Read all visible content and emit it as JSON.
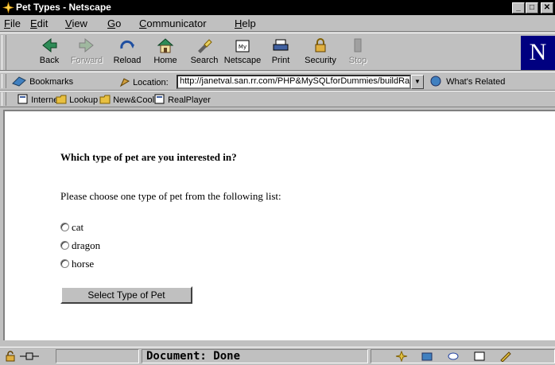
{
  "window": {
    "title": "Pet Types - Netscape"
  },
  "menu": [
    {
      "label": "File",
      "underline": "F",
      "rest": "ile"
    },
    {
      "label": "Edit",
      "underline": "E",
      "rest": "dit"
    },
    {
      "label": "View",
      "underline": "V",
      "rest": "iew"
    },
    {
      "label": "Go",
      "underline": "G",
      "rest": "o"
    },
    {
      "label": "Communicator",
      "underline": "C",
      "rest": "ommunicator"
    },
    {
      "label": "Help",
      "underline": "H",
      "rest": "elp"
    }
  ],
  "toolbar": {
    "back": "Back",
    "forward": "Forward",
    "reload": "Reload",
    "home": "Home",
    "search": "Search",
    "netscape": "Netscape",
    "print": "Print",
    "security": "Security",
    "stop": "Stop",
    "logo": "N"
  },
  "location_bar": {
    "bookmarks": "Bookmarks",
    "location_label": "Location:",
    "url": "http://janetval.san.rr.com/PHP&MySQLforDummies/buildRa",
    "whats_related": "What's Related"
  },
  "personal_toolbar": [
    "Internet",
    "Lookup",
    "New&Cool",
    "RealPlayer"
  ],
  "page": {
    "heading": "Which type of pet are you interested in?",
    "instruction": "Please choose one type of pet from the following list:",
    "options": [
      "cat",
      "dragon",
      "horse"
    ],
    "submit_label": "Select Type of Pet"
  },
  "status": {
    "text": "Document: Done"
  },
  "colors": {
    "title_bg": "#000000",
    "chrome": "#c0c0c0",
    "content_bg": "#ffffff",
    "logo_bg": "#000080"
  }
}
